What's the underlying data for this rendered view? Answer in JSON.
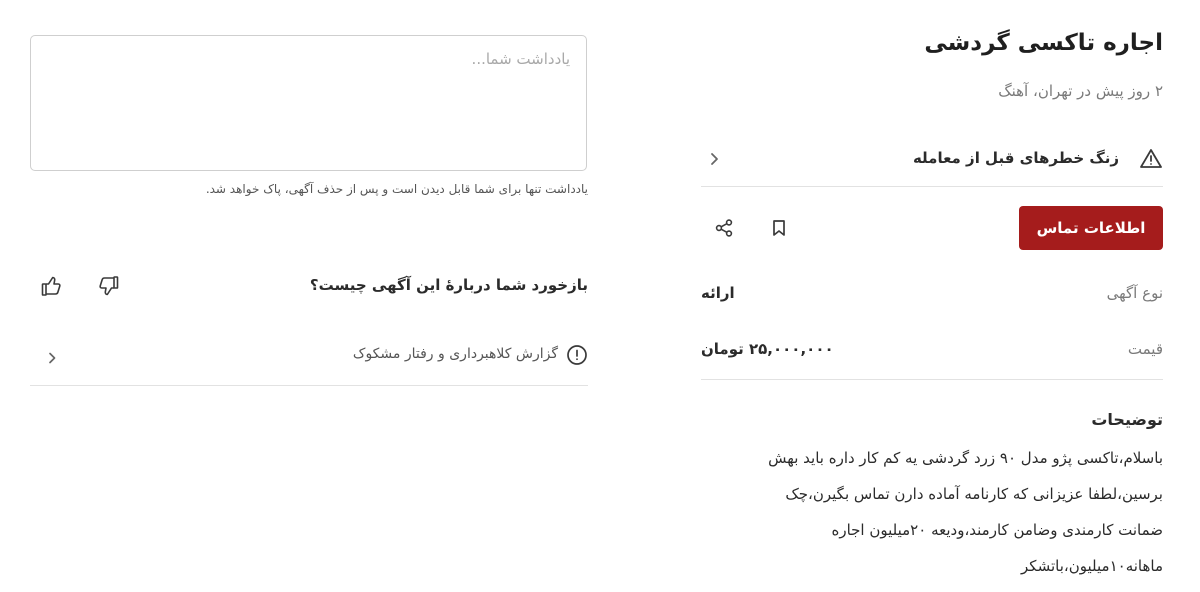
{
  "ad": {
    "title": "اجاره تاکسی گردشی",
    "subtitle": "۲ روز پیش در تهران، آهنگ"
  },
  "alert": {
    "label": "زنگ خطرهای قبل از معامله",
    "icon": "warning-icon"
  },
  "actions": {
    "contact_label": "اطلاعات تماس",
    "bookmark_icon": "bookmark-icon",
    "share_icon": "share-icon",
    "accent_color": "#a51c1c"
  },
  "details": {
    "type_key": "نوع آگهی",
    "type_value": "ارائه",
    "price_key": "قیمت",
    "price_value": "۲۵,۰۰۰,۰۰۰ تومان"
  },
  "description": {
    "heading": "توضیحات",
    "lines": [
      "باسلام،تاکسی پژو مدل ۹۰ زرد گردشی یه کم کار داره باید بهش",
      "برسین،لطفا عزیزانی که کارنامه آماده دارن تماس بگیرن،چک",
      "ضمانت کارمندی وضامن کارمند،ودیعه ۲۰میلیون اجاره",
      "ماهانه۱۰میلیون،باتشکر"
    ]
  },
  "note": {
    "placeholder": "یادداشت شما...",
    "value": "",
    "hint": "یادداشت تنها برای شما قابل دیدن است و پس از حذف آگهی، پاک خواهد شد."
  },
  "feedback": {
    "question": "بازخورد شما دربارهٔ این آگهی چیست؟",
    "like_icon": "thumbs-up-icon",
    "dislike_icon": "thumbs-down-icon"
  },
  "report": {
    "label": "گزارش کلاهبرداری و رفتار مشکوک",
    "icon": "info-icon"
  }
}
